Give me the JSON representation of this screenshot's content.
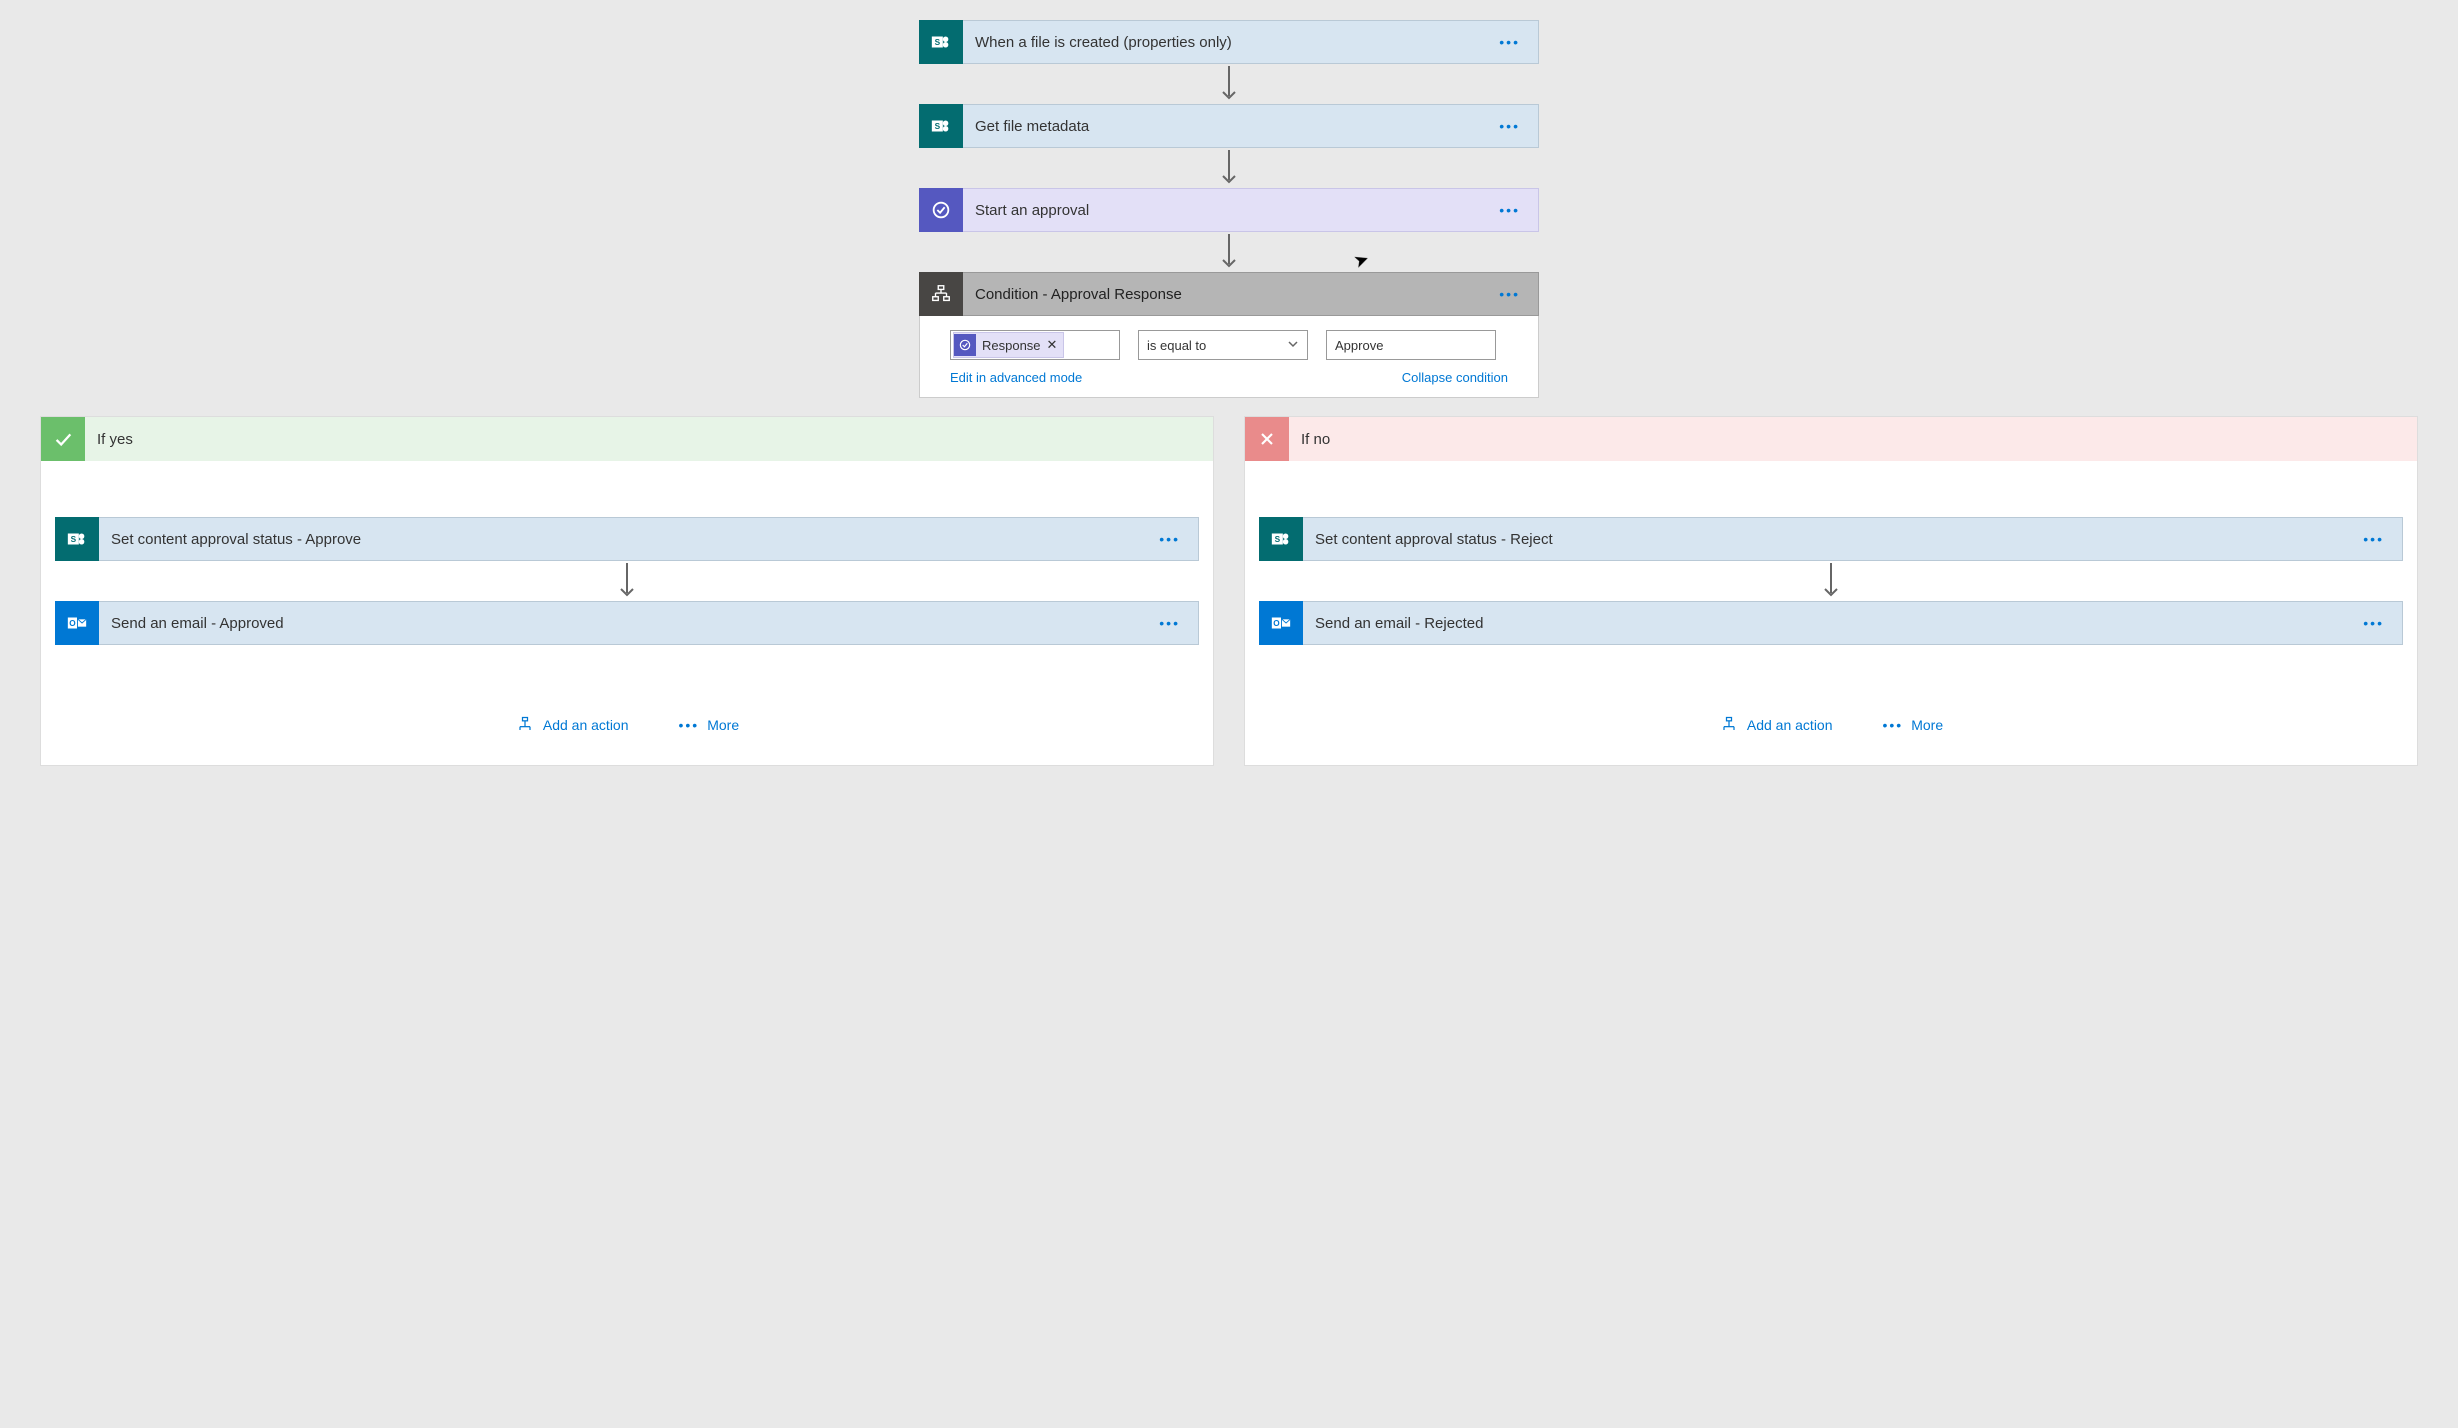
{
  "steps": {
    "s1": "When a file is created (properties only)",
    "s2": "Get file metadata",
    "s3": "Start an approval",
    "s4": "Condition - Approval Response"
  },
  "condition": {
    "token_label": "Response",
    "operator": "is equal to",
    "value": "Approve",
    "edit_link": "Edit in advanced mode",
    "collapse_link": "Collapse condition"
  },
  "branches": {
    "yes": {
      "label": "If yes",
      "a1": "Set content approval status - Approve",
      "a2": "Send an email - Approved"
    },
    "no": {
      "label": "If no",
      "a1": "Set content approval status - Reject",
      "a2": "Send an email - Rejected"
    },
    "add_action": "Add an action",
    "more": "More"
  }
}
